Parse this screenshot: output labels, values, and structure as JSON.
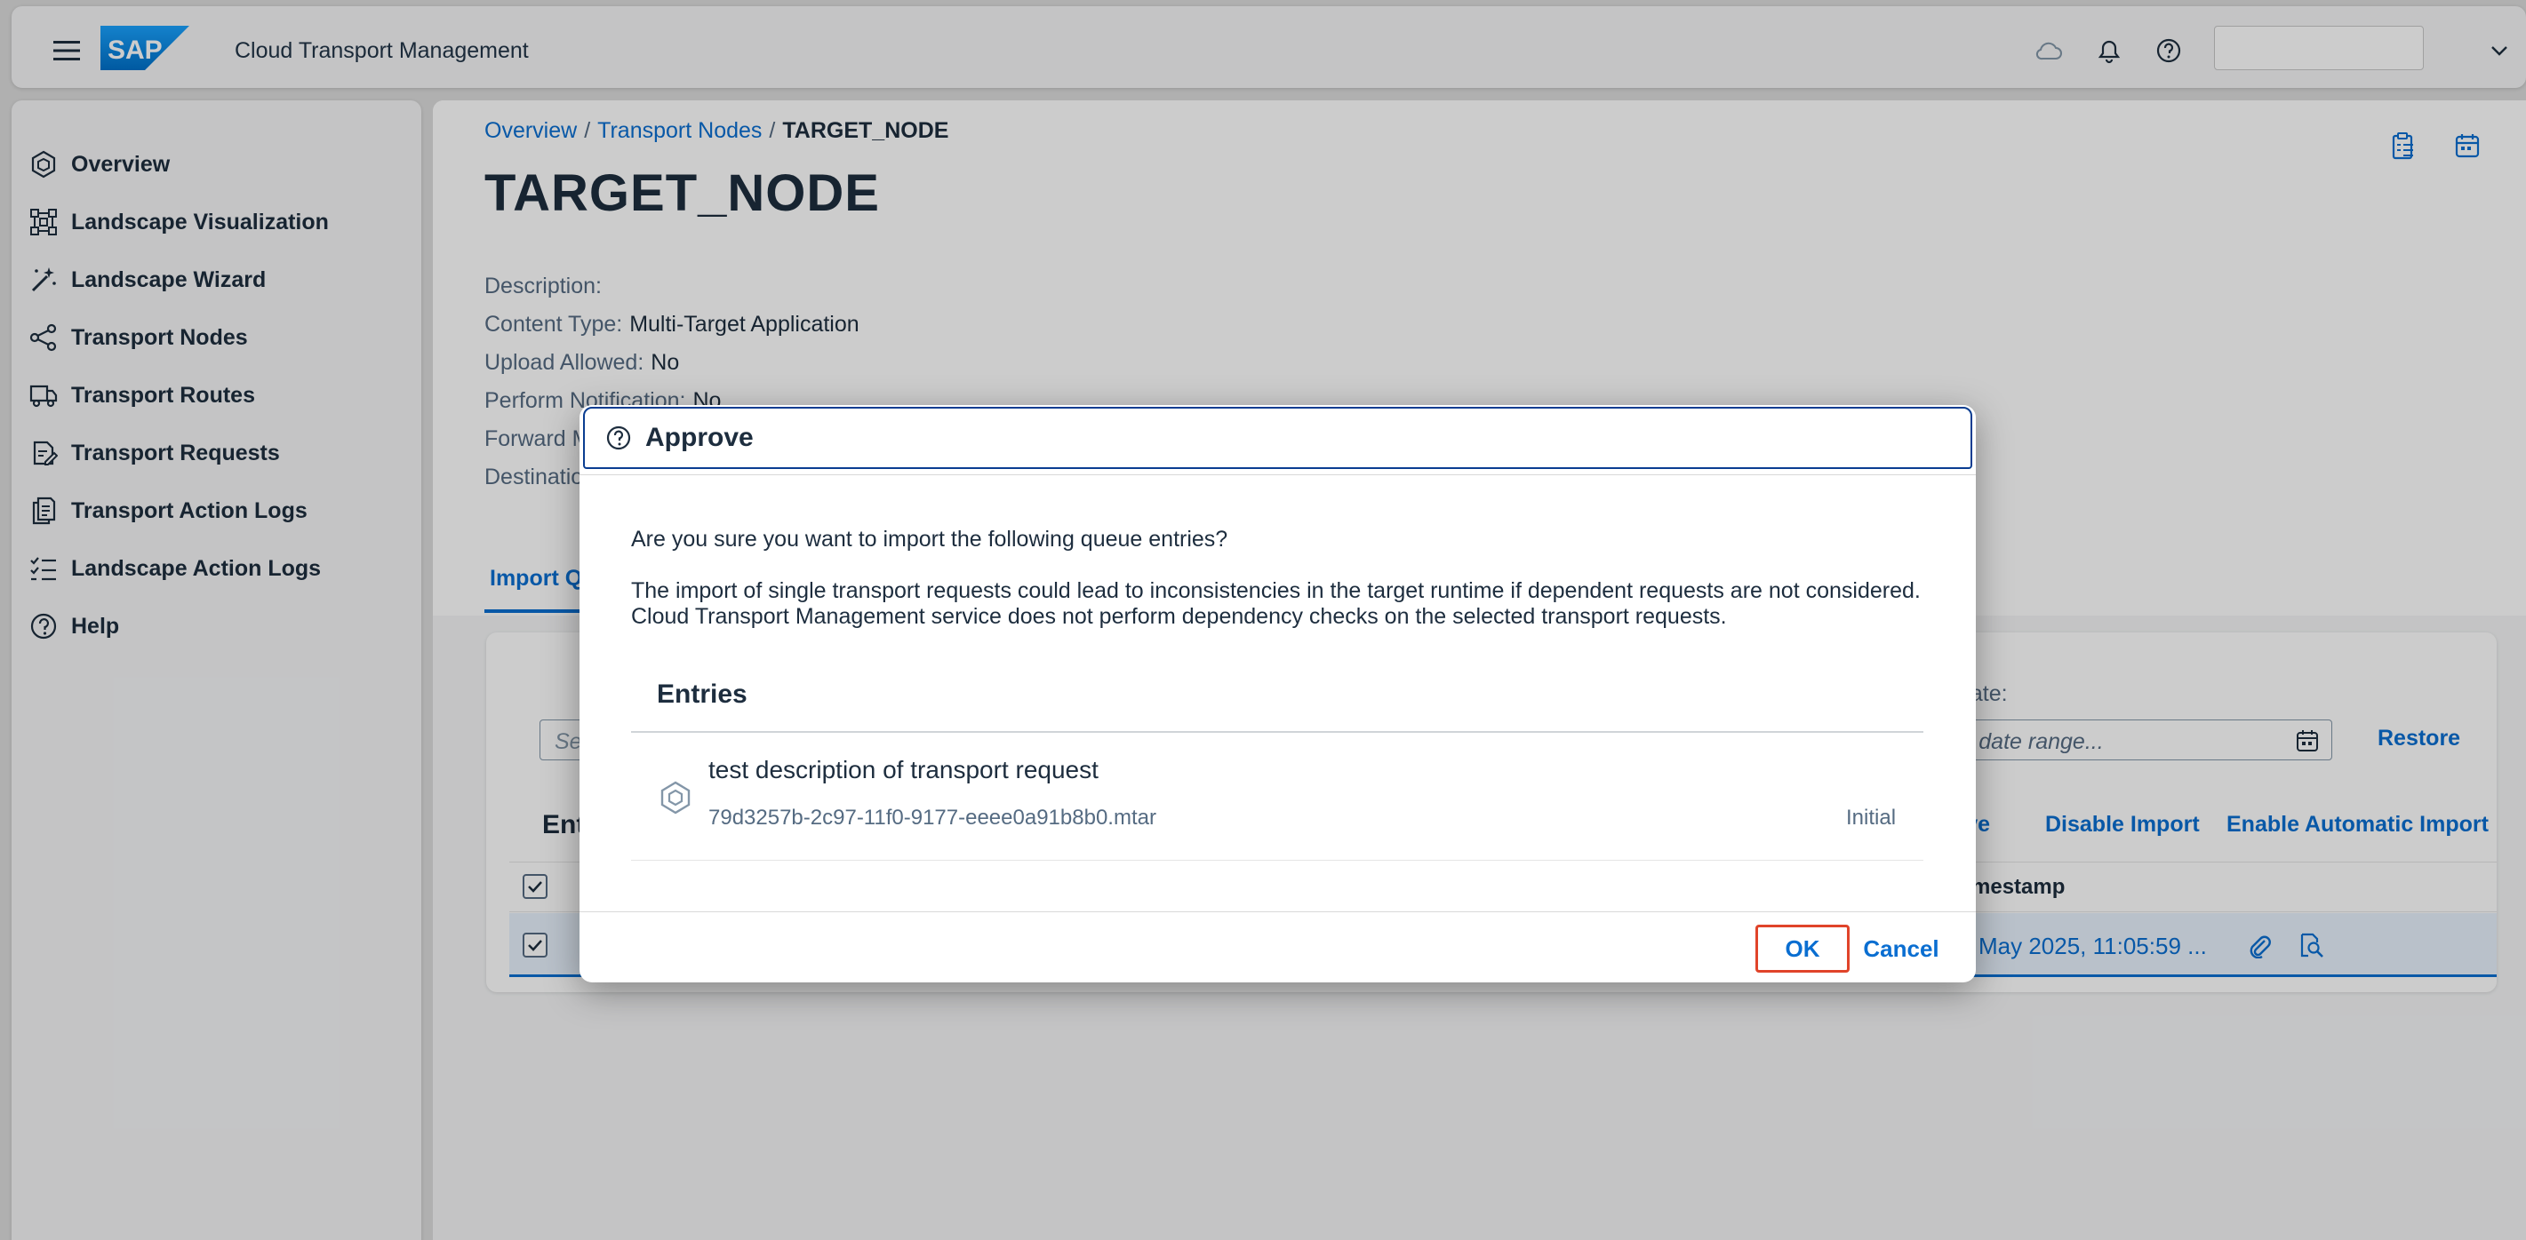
{
  "shell": {
    "title": "Cloud Transport Management",
    "logo_text": "SAP",
    "icons": [
      "menu-icon",
      "cloud-icon",
      "bell-icon",
      "help-icon",
      "chevron-down-icon"
    ],
    "user_value": ""
  },
  "sidebar": {
    "items": [
      {
        "label": "Overview",
        "icon": "overview-icon"
      },
      {
        "label": "Landscape Visualization",
        "icon": "landscape-visualization-icon"
      },
      {
        "label": "Landscape Wizard",
        "icon": "wizard-icon"
      },
      {
        "label": "Transport Nodes",
        "icon": "share-nodes-icon"
      },
      {
        "label": "Transport Routes",
        "icon": "truck-icon"
      },
      {
        "label": "Transport Requests",
        "icon": "request-icon"
      },
      {
        "label": "Transport Action Logs",
        "icon": "documents-icon"
      },
      {
        "label": "Landscape Action Logs",
        "icon": "checklist-icon"
      },
      {
        "label": "Help",
        "icon": "help-icon"
      }
    ]
  },
  "breadcrumb": {
    "items": [
      "Overview",
      "Transport Nodes"
    ],
    "separator": "/",
    "current": "TARGET_NODE"
  },
  "page": {
    "title": "TARGET_NODE",
    "attributes": [
      {
        "label": "Description:",
        "value": ""
      },
      {
        "label": "Content Type:",
        "value": "Multi-Target Application"
      },
      {
        "label": "Upload Allowed:",
        "value": "No"
      },
      {
        "label": "Perform Notification:",
        "value": "No"
      },
      {
        "label": "Forward M",
        "value": ""
      },
      {
        "label": "Destinatio",
        "value": ""
      }
    ],
    "tab_label": "Import Q"
  },
  "table": {
    "search_placeholder": "Se",
    "date_label": "n Date:",
    "date_placeholder": "r date range...",
    "restore_label": "Restore",
    "entries_heading": "Ent",
    "actions": [
      "ove",
      "Disable Import",
      "Enable Automatic Import"
    ],
    "timestamp_header": "mestamp",
    "row_timestamp": "May 2025, 11:05:59 ..."
  },
  "dialog": {
    "title": "Approve",
    "question": "Are you sure you want to import the following queue entries?",
    "warning_line1": "The import of single transport requests could lead to inconsistencies in the target runtime if dependent requests are not considered.",
    "warning_line2": "Cloud Transport Management service does not perform dependency checks on the selected transport requests.",
    "entries_title": "Entries",
    "entry": {
      "title": "test description of transport request",
      "file": "79d3257b-2c97-11f0-9177-eeee0a91b8b0.mtar",
      "status": "Initial"
    },
    "ok_label": "OK",
    "cancel_label": "Cancel"
  },
  "colors": {
    "accent": "#0a6ed1",
    "text": "#1d2d3e",
    "muted": "#556b82",
    "highlight": "#e0442a"
  }
}
